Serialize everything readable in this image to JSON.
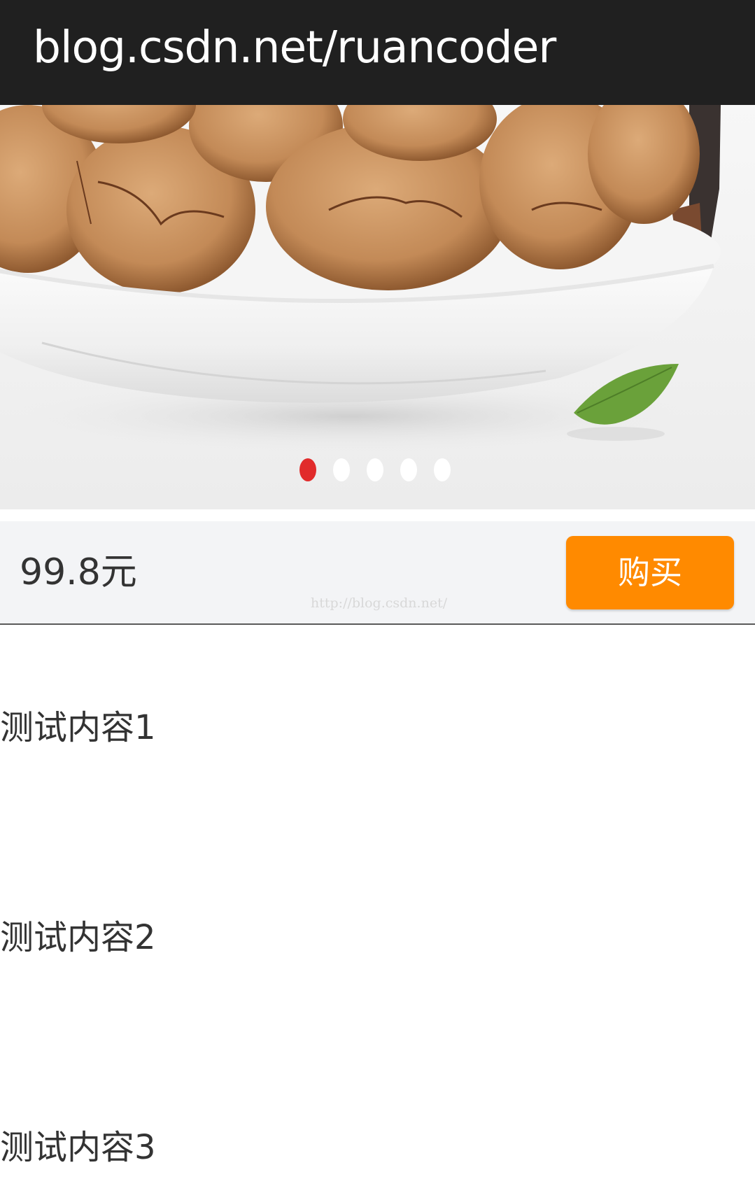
{
  "header": {
    "title": "blog.csdn.net/ruancoder"
  },
  "banner": {
    "image_label": "pecans in white bowl with leaf",
    "indicator": {
      "count": 5,
      "active_index": 0,
      "active_color": "#e12b2b",
      "inactive_color": "#ffffff"
    }
  },
  "product": {
    "price": "99.8元",
    "buy_label": "购买",
    "buy_color": "#ff8a00",
    "watermark": "http://blog.csdn.net/"
  },
  "content": {
    "items": [
      {
        "label": "测试内容1"
      },
      {
        "label": "测试内容2"
      },
      {
        "label": "测试内容3"
      }
    ]
  }
}
